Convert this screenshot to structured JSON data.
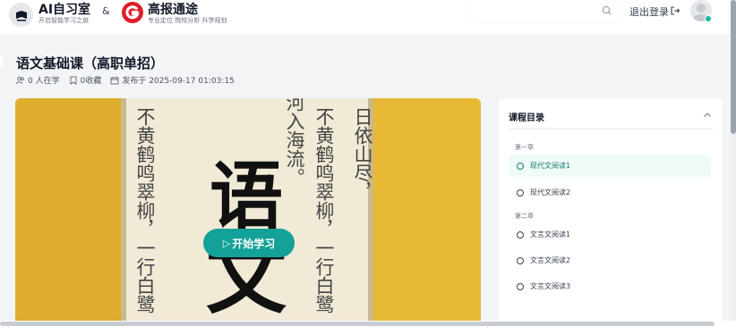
{
  "header": {
    "brand1_title": "AI自习室",
    "brand1_sub": "开启智能学习之旅",
    "amp": "&",
    "brand2_title": "高报通途",
    "brand2_sub": "专业定位 院校分析 升学规划",
    "logout_label": "退出登录",
    "search_placeholder": ""
  },
  "course": {
    "title": "语文基础课（高职单招）",
    "learners": "0 人在学",
    "favorites": "0收藏",
    "published": "发布于 2025-09-17 01:03:15",
    "start_button": "开始学习",
    "cover_char_top": "语",
    "cover_char_bottom": "文",
    "cover_poem_cols": [
      "不黄鹤鸣翠柳，一行白鹭",
      "河入海流。",
      "不黄鹤鸣翠柳，一行白鹭",
      "日依山尽，"
    ]
  },
  "catalog": {
    "title": "课程目录",
    "chapters": [
      {
        "name": "第一章",
        "lessons": [
          "现代文阅读1",
          "现代文阅读2"
        ]
      },
      {
        "name": "第二章",
        "lessons": [
          "文言文阅读1",
          "文言文阅读2",
          "文言文阅读3"
        ]
      }
    ]
  },
  "colors": {
    "accent": "#14a197",
    "cover_bg": "#e8b935",
    "paper": "#f1ead6"
  },
  "icons": {
    "search": "search-icon",
    "logout": "logout-icon",
    "chevron": "chevron-up-icon",
    "play": "play-icon"
  }
}
